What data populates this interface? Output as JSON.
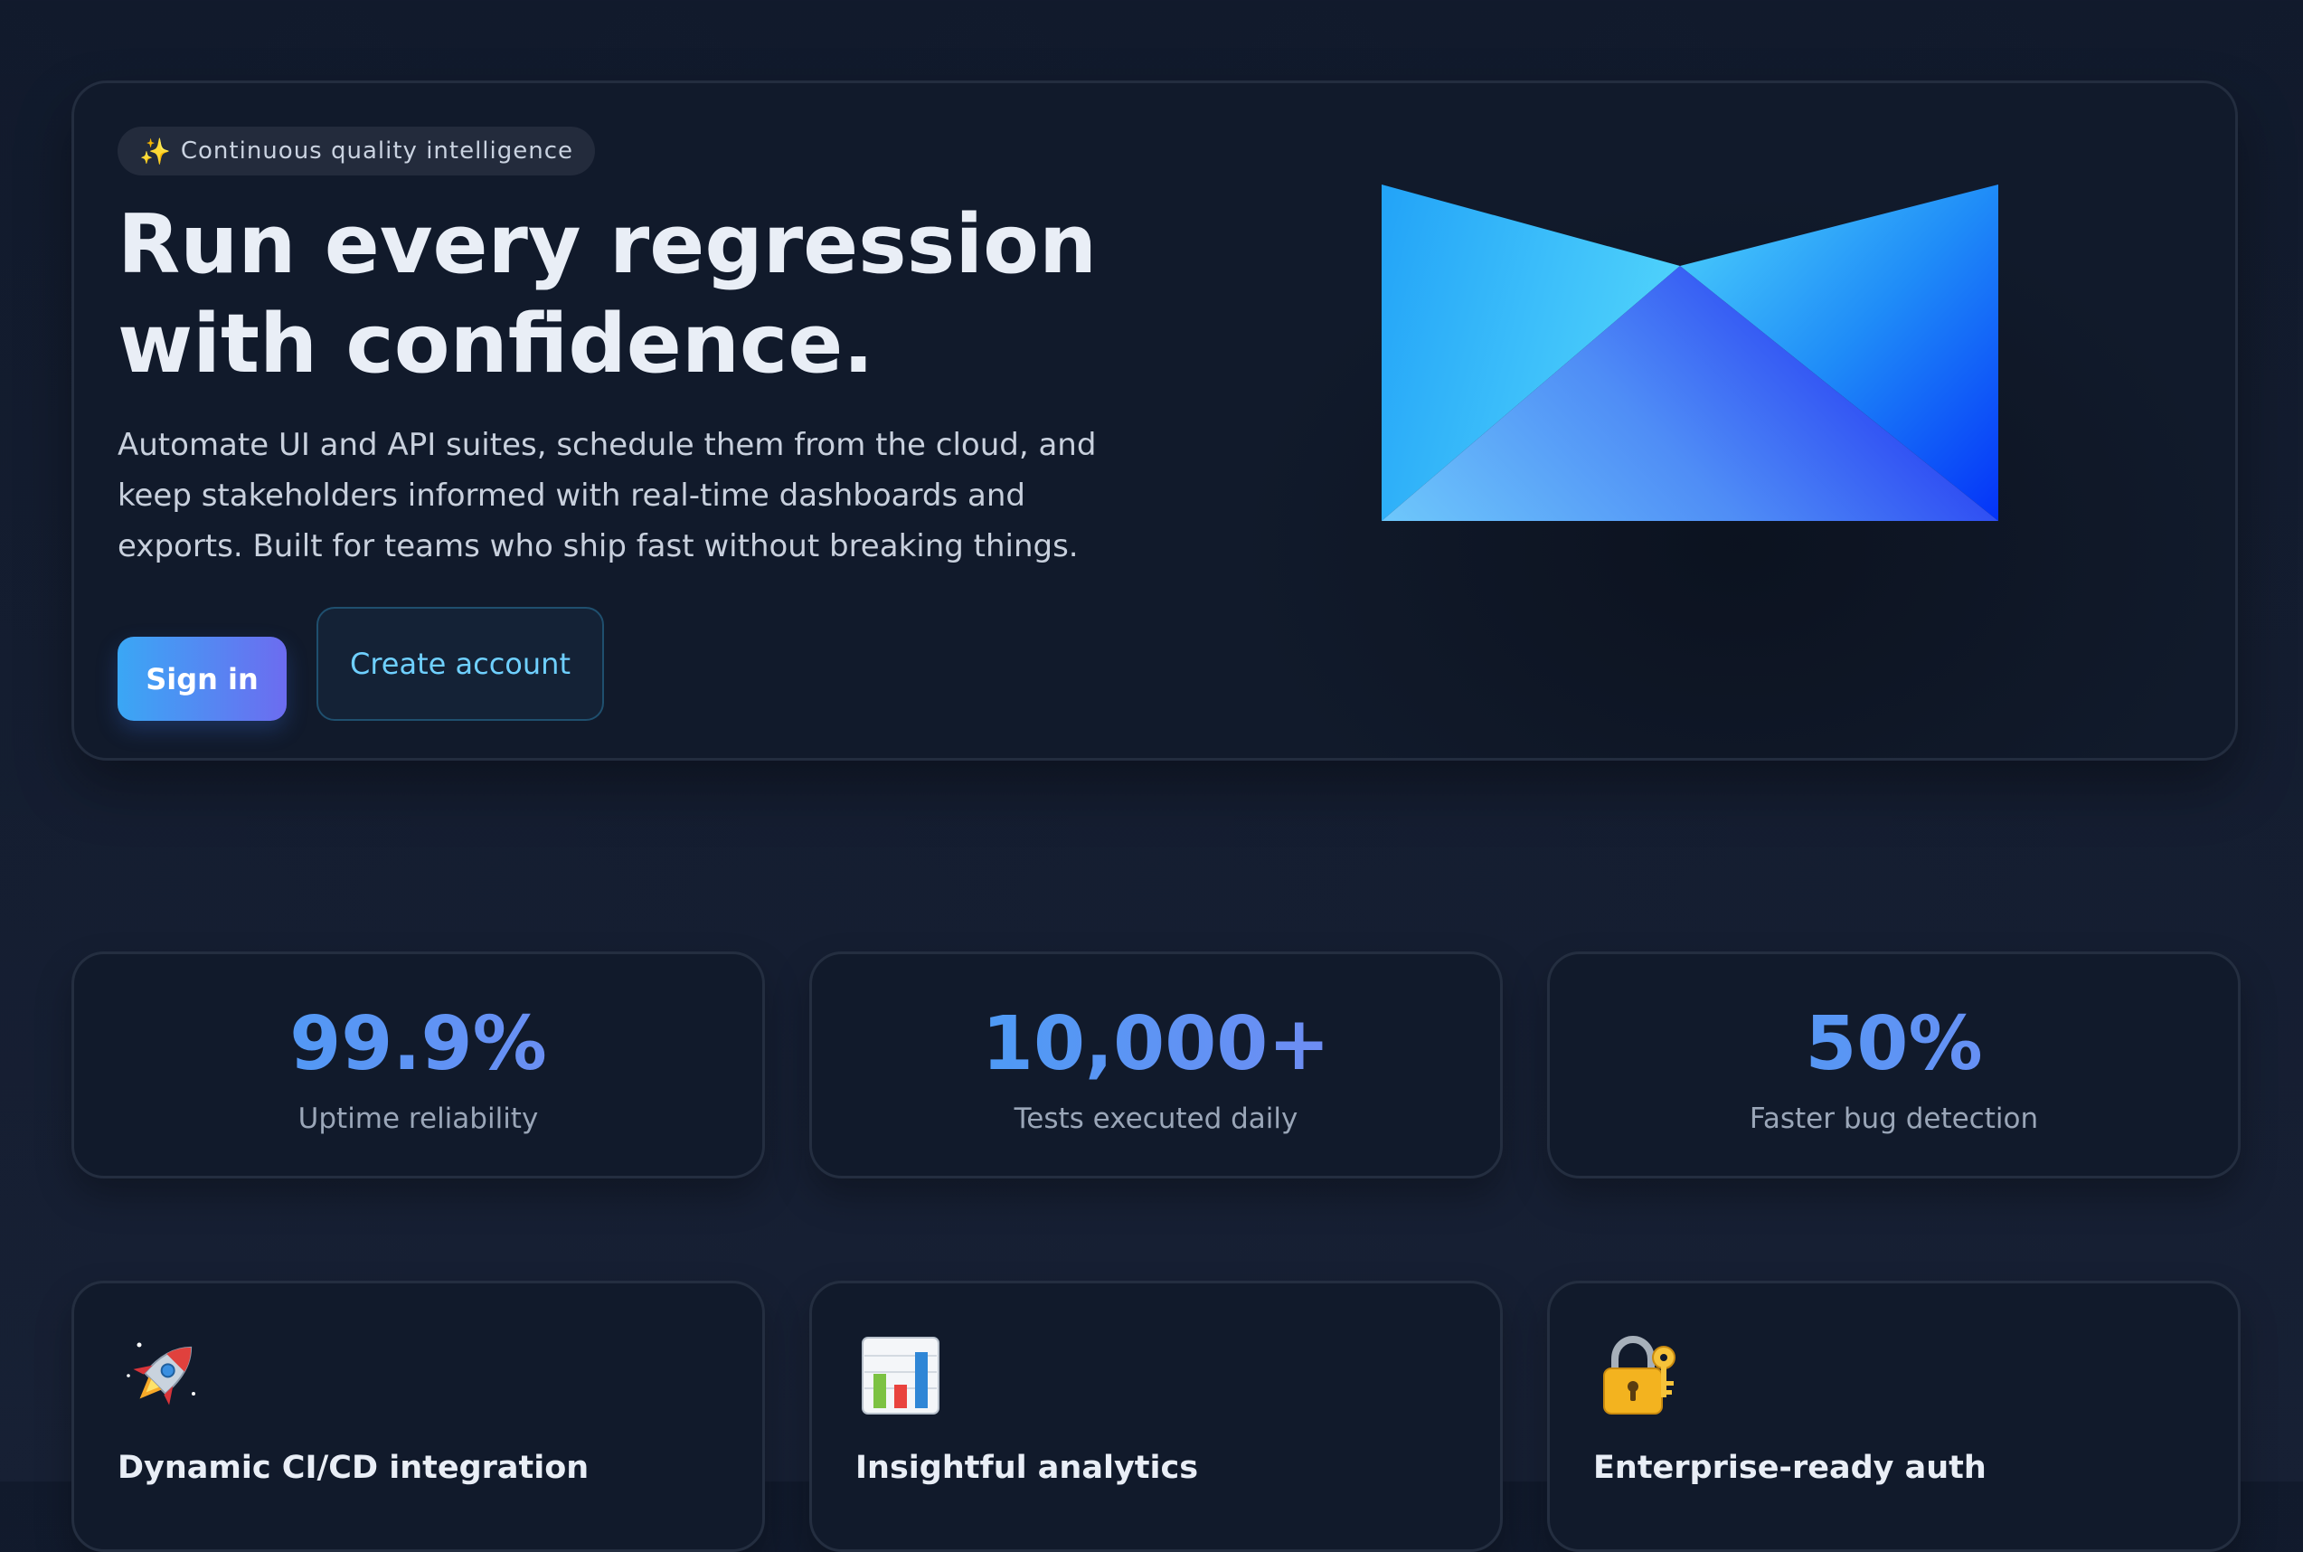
{
  "hero": {
    "badge_icon": "sparkles-icon",
    "badge_text": "Continuous quality intelligence",
    "title_line1": "Run every regression",
    "title_line2": "with confidence.",
    "subtitle_line1": "Automate UI and API suites, schedule them from the cloud, and",
    "subtitle_line2": "keep stakeholders informed with real-time dashboards and",
    "subtitle_line3": "exports. Built for teams who ship fast without breaking things.",
    "sign_in_label": "Sign in",
    "create_account_label": "Create account",
    "illustration": "blue-envelope-icon"
  },
  "stats": [
    {
      "value": "99.9%",
      "label": "Uptime reliability"
    },
    {
      "value": "10,000+",
      "label": "Tests executed daily"
    },
    {
      "value": "50%",
      "label": "Faster bug detection"
    }
  ],
  "features": [
    {
      "icon": "rocket-icon",
      "title": "Dynamic CI/CD integration"
    },
    {
      "icon": "bar-chart-icon",
      "title": "Insightful analytics"
    },
    {
      "icon": "lock-with-key-icon",
      "title": "Enterprise-ready auth"
    }
  ],
  "colors": {
    "background": "#111a2c",
    "card": "#111a2b",
    "accent_start": "#3ea1f6",
    "accent_end": "#7e86f2",
    "link": "#6fd0ff"
  }
}
